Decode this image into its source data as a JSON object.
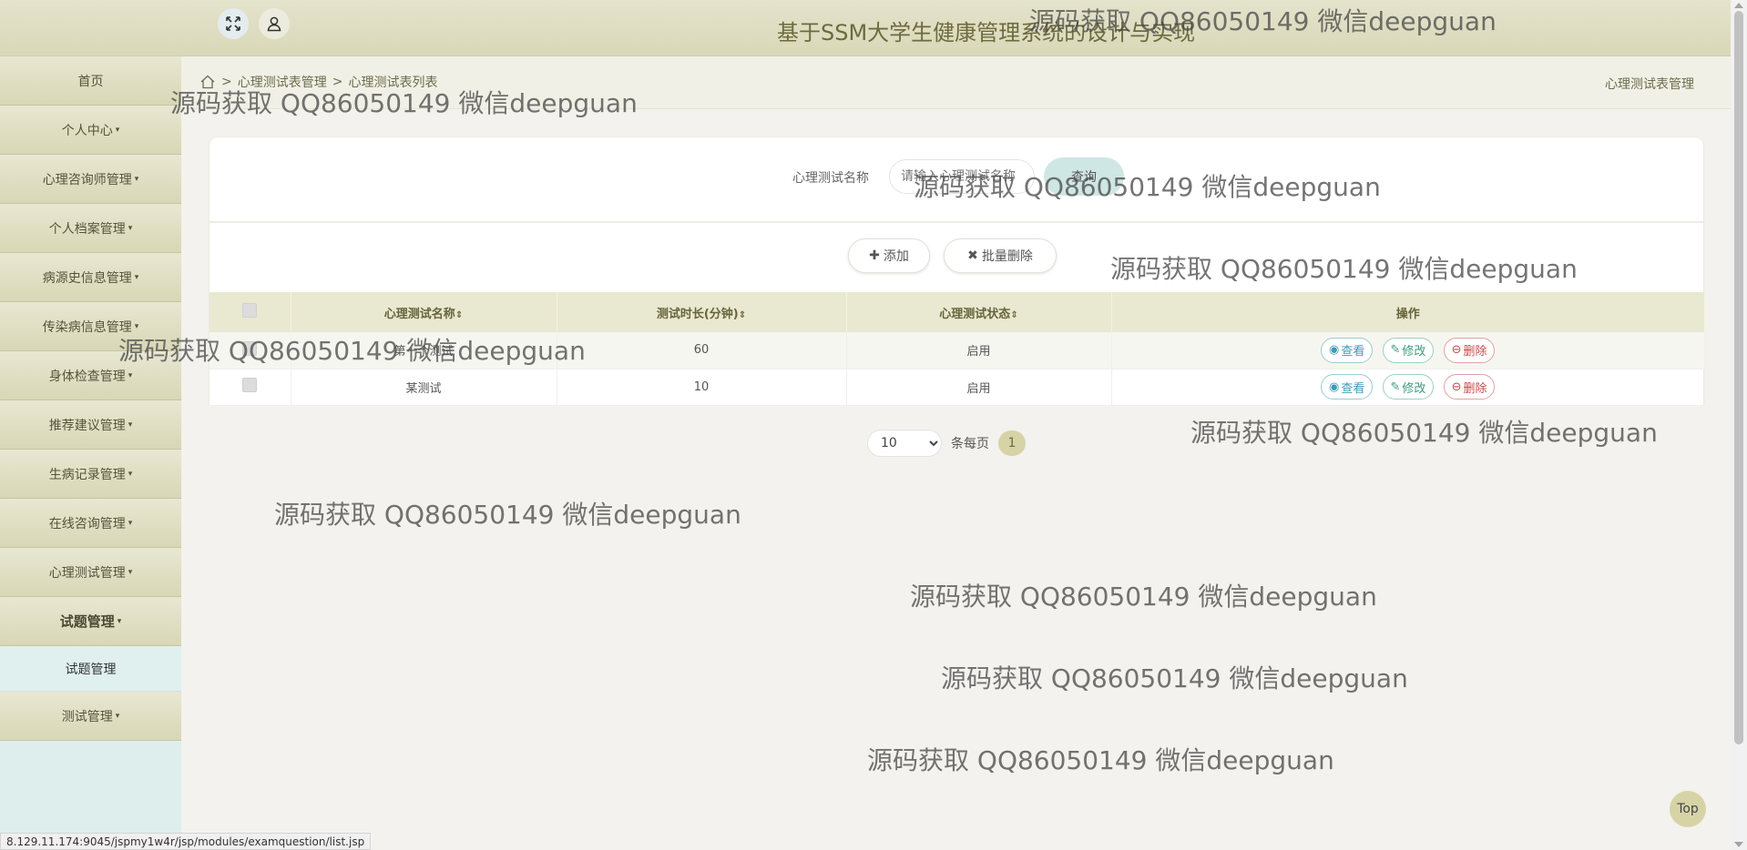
{
  "header": {
    "title": "基于SSM大学生健康管理系统的设计与实现"
  },
  "sidebar": {
    "items": [
      {
        "label": "首页",
        "caret": false
      },
      {
        "label": "个人中心",
        "caret": true
      },
      {
        "label": "心理咨询师管理",
        "caret": true
      },
      {
        "label": "个人档案管理",
        "caret": true
      },
      {
        "label": "病源史信息管理",
        "caret": true
      },
      {
        "label": "传染病信息管理",
        "caret": true
      },
      {
        "label": "身体检查管理",
        "caret": true
      },
      {
        "label": "推荐建议管理",
        "caret": true
      },
      {
        "label": "生病记录管理",
        "caret": true
      },
      {
        "label": "在线咨询管理",
        "caret": true
      },
      {
        "label": "心理测试管理",
        "caret": true
      },
      {
        "label": "试题管理",
        "caret": true
      },
      {
        "label": "测试管理",
        "caret": true
      }
    ],
    "submenu_label": "试题管理",
    "caret_glyph": "▾"
  },
  "breadcrumb": {
    "sep": ">",
    "level1": "心理测试表管理",
    "level2": "心理测试表列表",
    "right": "心理测试表管理"
  },
  "search": {
    "label": "心理测试名称",
    "placeholder": "请输入心理测试名称",
    "button": "查询"
  },
  "actions": {
    "add": "添加",
    "batch_delete": "批量删除"
  },
  "table": {
    "headers": [
      "心理测试名称",
      "测试时长(分钟)",
      "心理测试状态",
      "操作"
    ],
    "sort_glyph": "⇕",
    "rows": [
      {
        "name": "第一个测试",
        "duration": "60",
        "status": "启用"
      },
      {
        "name": "某测试",
        "duration": "10",
        "status": "启用"
      }
    ],
    "ops": {
      "view": "查看",
      "edit": "修改",
      "delete": "删除"
    }
  },
  "pagination": {
    "page_size": "10",
    "per_page_label": "条每页",
    "current_page": "1"
  },
  "watermark": "源码获取 QQ86050149 微信deepguan",
  "top_button": "Top",
  "status_url": "8.129.11.174:9045/jspmy1w4r/jsp/modules/examquestion/list.jsp"
}
